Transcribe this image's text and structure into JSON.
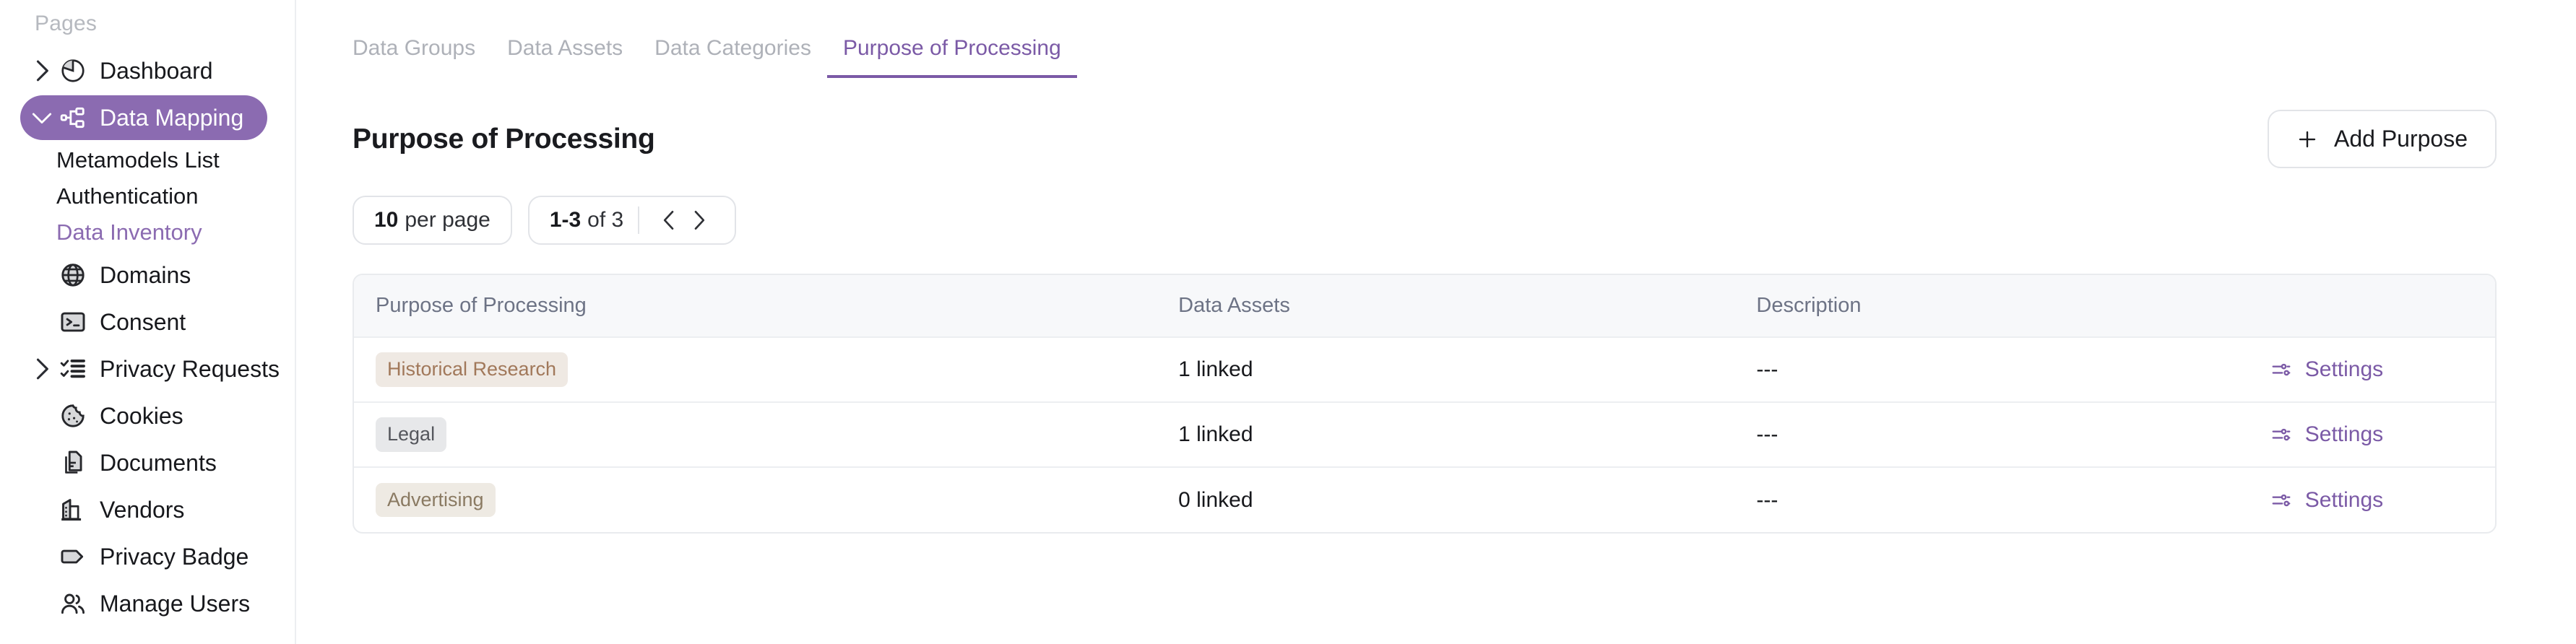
{
  "sidebar": {
    "heading": "Pages",
    "items": [
      {
        "label": "Dashboard",
        "icon": "pie-chart-icon",
        "chevron": "right",
        "active": false
      },
      {
        "label": "Data Mapping",
        "icon": "sitemap-icon",
        "chevron": "down",
        "active": true
      }
    ],
    "sub_items": [
      {
        "label": "Metamodels List",
        "current": false
      },
      {
        "label": "Authentication",
        "current": false
      },
      {
        "label": "Data Inventory",
        "current": true
      }
    ],
    "items_after": [
      {
        "label": "Domains",
        "icon": "globe-icon",
        "chevron": null,
        "active": false
      },
      {
        "label": "Consent",
        "icon": "terminal-icon",
        "chevron": null,
        "active": false
      },
      {
        "label": "Privacy Requests",
        "icon": "checklist-icon",
        "chevron": "right",
        "active": false
      },
      {
        "label": "Cookies",
        "icon": "cookie-icon",
        "chevron": null,
        "active": false
      },
      {
        "label": "Documents",
        "icon": "documents-icon",
        "chevron": null,
        "active": false
      },
      {
        "label": "Vendors",
        "icon": "building-icon",
        "chevron": null,
        "active": false
      },
      {
        "label": "Privacy Badge",
        "icon": "tag-icon",
        "chevron": null,
        "active": false
      },
      {
        "label": "Manage Users",
        "icon": "users-icon",
        "chevron": null,
        "active": false
      }
    ]
  },
  "tabs": [
    {
      "label": "Data Groups",
      "selected": false
    },
    {
      "label": "Data Assets",
      "selected": false
    },
    {
      "label": "Data Categories",
      "selected": false
    },
    {
      "label": "Purpose of Processing",
      "selected": true
    }
  ],
  "page": {
    "title": "Purpose of Processing",
    "add_button_label": "Add Purpose"
  },
  "pager": {
    "per_page_value": "10",
    "per_page_suffix": "per page",
    "range": "1-3",
    "range_suffix": "of 3",
    "prev_label": "‹",
    "next_label": "›"
  },
  "table": {
    "columns": [
      "Purpose of Processing",
      "Data Assets",
      "Description",
      ""
    ],
    "rows": [
      {
        "purpose": "Historical Research",
        "badge_bg": "#efe9e3",
        "badge_fg": "#a1785a",
        "data_assets": "1 linked",
        "description": "---",
        "settings_label": "Settings"
      },
      {
        "purpose": "Legal",
        "badge_bg": "#e7e8ea",
        "badge_fg": "#55575d",
        "data_assets": "1 linked",
        "description": "---",
        "settings_label": "Settings"
      },
      {
        "purpose": "Advertising",
        "badge_bg": "#eeeae3",
        "badge_fg": "#8a7a62",
        "data_assets": "0 linked",
        "description": "---",
        "settings_label": "Settings"
      }
    ]
  },
  "colors": {
    "accent_purple": "#7b5aa6",
    "active_pill": "#8b6bb1",
    "header_bg": "#f7f8fa",
    "border": "#e9ebee",
    "muted_text": "#aeb1b8"
  }
}
